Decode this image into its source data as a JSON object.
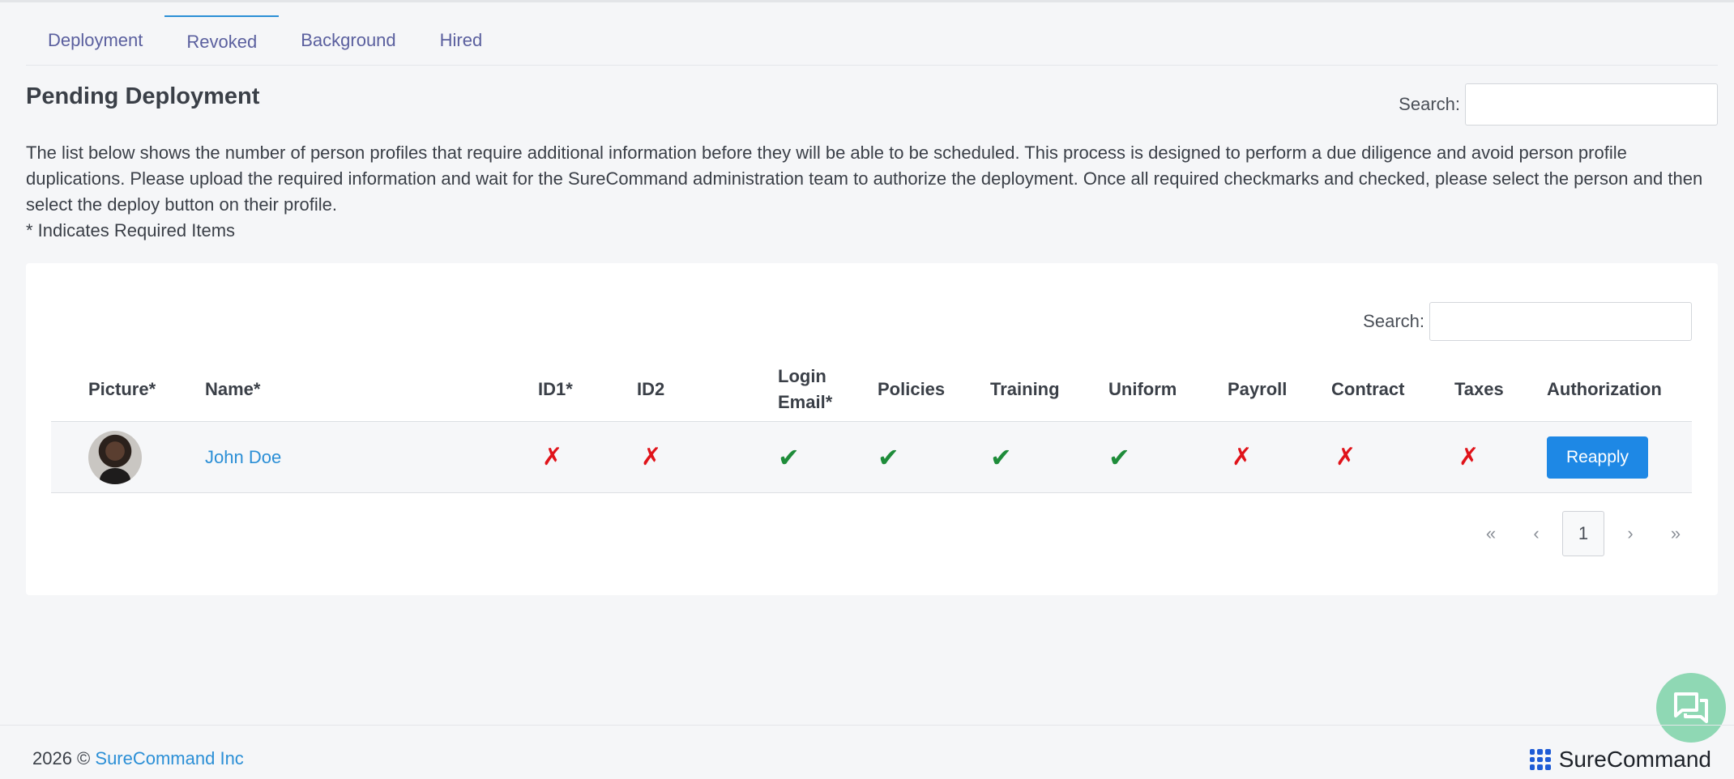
{
  "tabs": [
    {
      "label": "Deployment",
      "active": false
    },
    {
      "label": "Revoked",
      "active": true
    },
    {
      "label": "Background",
      "active": false
    },
    {
      "label": "Hired",
      "active": false
    }
  ],
  "page_title": "Pending Deployment",
  "top_search": {
    "label": "Search:",
    "value": ""
  },
  "description": {
    "paragraph": "The list below shows the number of person profiles that require additional information before they will be able to be scheduled. This process is designed to perform a due diligence and avoid person profile duplications. Please upload the required information and wait for the SureCommand administration team to authorize the deployment. Once all required checkmarks and checked, please select the person and then select the deploy button on their profile.",
    "note": "* Indicates Required Items"
  },
  "table_search": {
    "label": "Search:",
    "value": ""
  },
  "table": {
    "headers": [
      "Picture*",
      "Name*",
      "ID1*",
      "ID2",
      "Login Email*",
      "Policies",
      "Training",
      "Uniform",
      "Payroll",
      "Contract",
      "Taxes",
      "Authorization"
    ],
    "rows": [
      {
        "name": "John Doe",
        "id1": "✗",
        "id2": "✗",
        "login_email": "✔",
        "policies": "✔",
        "training": "✔",
        "uniform": "✔",
        "payroll": "✗",
        "contract": "✗",
        "taxes": "✗",
        "action": "Reapply"
      }
    ]
  },
  "pagination": {
    "first": "«",
    "prev": "‹",
    "current": "1",
    "next": "›",
    "last": "»"
  },
  "footer": {
    "year": "2026 ©",
    "company": "SureCommand Inc",
    "brand": "SureCommand"
  },
  "colors": {
    "accent": "#1e88e5",
    "link": "#2b8fd6",
    "tab": "#5a5f9e",
    "cross": "#e0131a",
    "check": "#1e8c3a",
    "chat": "#8fd8b4"
  }
}
